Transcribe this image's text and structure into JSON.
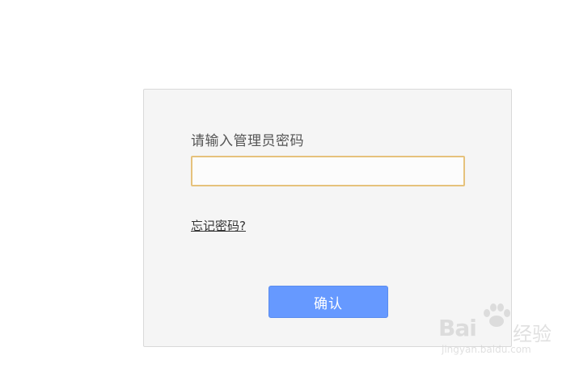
{
  "login": {
    "prompt_label": "请输入管理员密码",
    "password_value": "",
    "forgot_link": "忘记密码?",
    "confirm_label": "确认"
  },
  "watermark": {
    "brand": "Bai",
    "brand_suffix": "经验",
    "url": "jingyan.baidu.com",
    "icon": "paw-icon"
  },
  "colors": {
    "panel_background": "#f5f5f5",
    "input_border": "#e6c27c",
    "button": "#6699ff"
  }
}
